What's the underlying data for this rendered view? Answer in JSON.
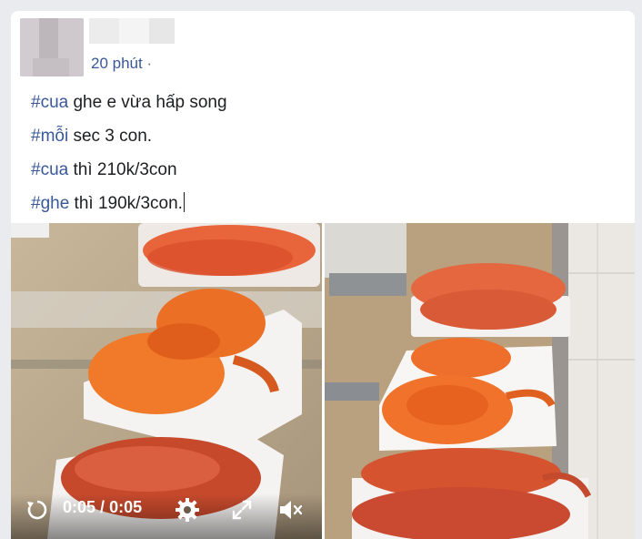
{
  "post": {
    "time": "20 phút",
    "separator": "·",
    "lines": [
      {
        "hashtag": "#cua",
        "text": " ghe e vừa hấp song"
      },
      {
        "hashtag": "#mỗi",
        "text": " sec 3 con."
      },
      {
        "hashtag": "#cua",
        "text": " thì 210k/3con"
      },
      {
        "hashtag": "#ghe",
        "text": " thì 190k/3con."
      }
    ]
  },
  "video": {
    "current_time": "0:05",
    "divider": "/",
    "duration": "0:05",
    "icons": [
      "replay-icon",
      "settings-gear-icon",
      "fullscreen-icon",
      "mute-icon"
    ]
  },
  "colors": {
    "hashtag": "#385898",
    "text": "#1c1e21",
    "meta": "#65676b"
  }
}
